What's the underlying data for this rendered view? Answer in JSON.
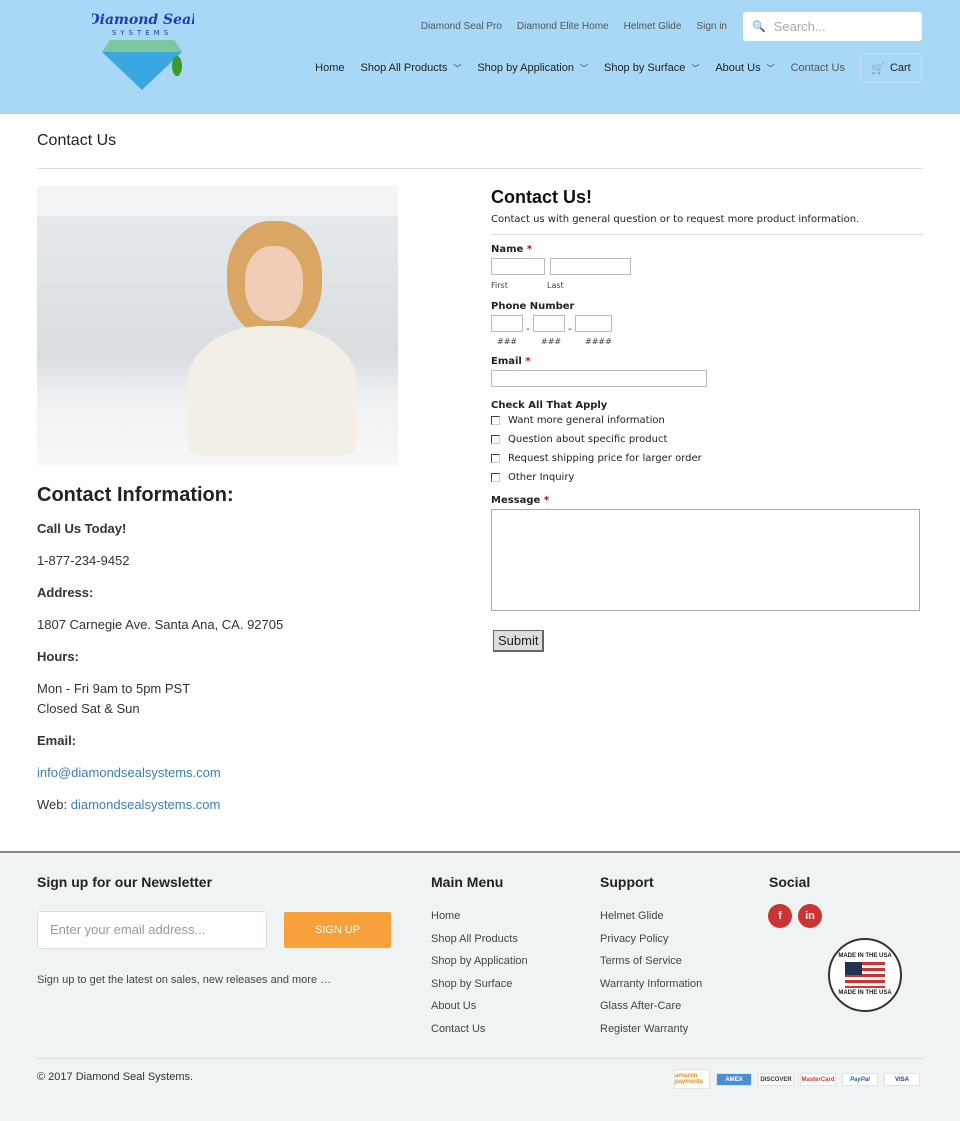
{
  "header": {
    "logo_text": "Diamond Seal SYSTEMS",
    "top_links": [
      "Diamond Seal Pro",
      "Diamond Elite Home",
      "Helmet Glide",
      "Sign in"
    ],
    "search_placeholder": "Search...",
    "nav": [
      {
        "label": "Home",
        "dropdown": false
      },
      {
        "label": "Shop All Products",
        "dropdown": true
      },
      {
        "label": "Shop by Application",
        "dropdown": true
      },
      {
        "label": "Shop by Surface",
        "dropdown": true
      },
      {
        "label": "About Us",
        "dropdown": true
      },
      {
        "label": "Contact Us",
        "dropdown": false
      }
    ],
    "cart": "Cart"
  },
  "page_title": "Contact Us",
  "contact": {
    "heading": "Contact Information:",
    "call_label": "Call Us Today!",
    "phone": "1-877-234-9452",
    "address_label": "Address:",
    "address": "1807 Carnegie Ave. Santa Ana, CA. 92705",
    "hours_label": "Hours:",
    "hours1": "Mon - Fri 9am to 5pm PST",
    "hours2": "Closed Sat & Sun",
    "email_label": "Email:",
    "email": "info@diamondsealsystems.com",
    "web_label": "Web:",
    "web": "diamondsealsystems.com"
  },
  "form": {
    "title": "Contact Us!",
    "subtitle": "Contact us with general question or to request more product information.",
    "name_label": "Name",
    "first": "First",
    "last": "Last",
    "phone_label": "Phone Number",
    "phone_hints": [
      "###",
      "###",
      "####"
    ],
    "email_label": "Email",
    "check_label": "Check All That Apply",
    "options": [
      "Want more general information",
      "Question about specific product",
      "Request shipping price for larger order",
      "Other Inquiry"
    ],
    "message_label": "Message",
    "required_mark": "*",
    "submit": "Submit"
  },
  "footer": {
    "newsletter_title": "Sign up for our Newsletter",
    "email_placeholder": "Enter your email address...",
    "signup": "SIGN UP",
    "note": "Sign up to get the latest on sales, new releases and more …",
    "main_menu_title": "Main Menu",
    "main_menu": [
      "Home",
      "Shop All Products",
      "Shop by Application",
      "Shop by Surface",
      "About Us",
      "Contact Us"
    ],
    "support_title": "Support",
    "support": [
      "Helmet Glide",
      "Privacy Policy",
      "Terms of Service",
      "Warranty Information",
      "Glass After-Care",
      "Register Warranty"
    ],
    "social_title": "Social",
    "social": [
      "f",
      "in"
    ],
    "badge": "MADE IN THE USA",
    "copyright": "© 2017 Diamond Seal Systems.",
    "payments": [
      "amazon payments",
      "AMEX",
      "DISCOVER",
      "MasterCard",
      "PayPal",
      "VISA"
    ]
  },
  "colors": {
    "header_bg": "#a8d8f5",
    "link": "#3d7eb5",
    "signup": "#f8a13a",
    "social": "#cc3333"
  }
}
